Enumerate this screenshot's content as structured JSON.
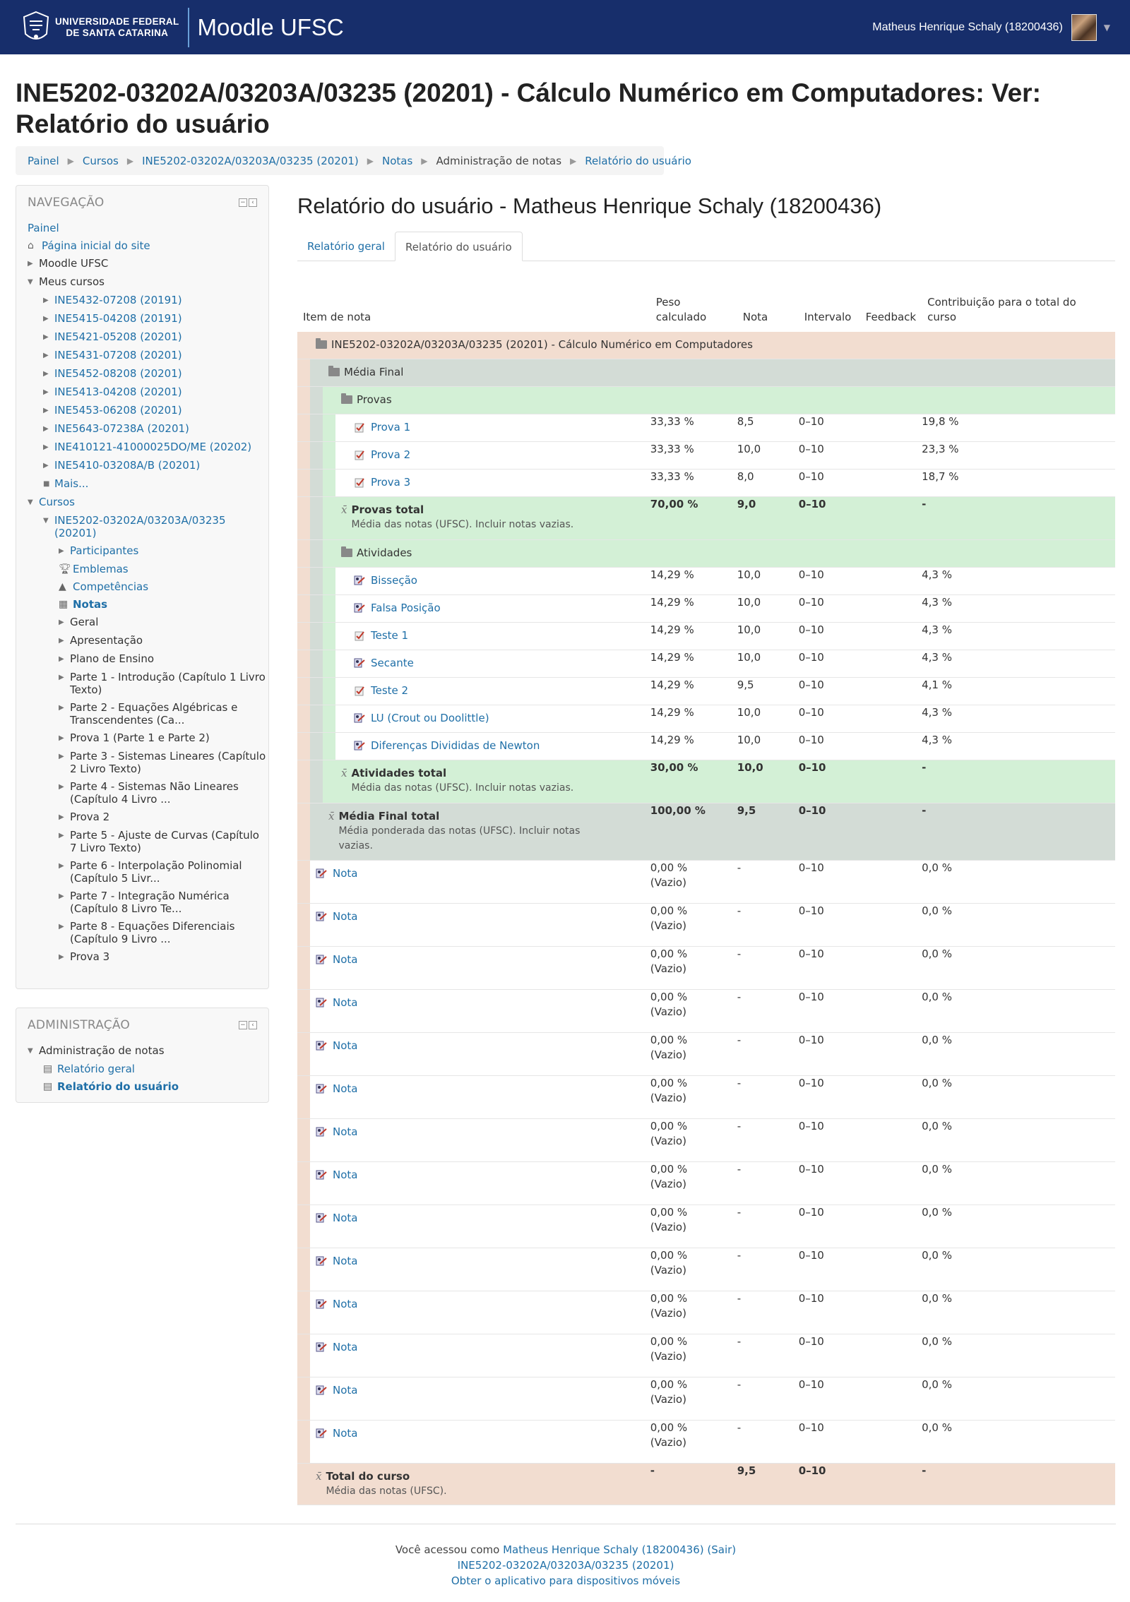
{
  "header": {
    "uni_line1": "UNIVERSIDADE FEDERAL",
    "uni_line2": "DE SANTA CATARINA",
    "brand": "Moodle UFSC",
    "user": "Matheus Henrique Schaly (18200436)"
  },
  "page_title": "INE5202-03202A/03203A/03235 (20201) - Cálculo Numérico em Computadores: Ver: Relatório do usuário",
  "breadcrumb": [
    "Painel",
    "Cursos",
    "INE5202-03202A/03203A/03235 (20201)",
    "Notas",
    "Administração de notas",
    "Relatório do usuário"
  ],
  "nav": {
    "title": "NAVEGAÇÃO",
    "painel": "Painel",
    "home": "Página inicial do site",
    "moodle": "Moodle UFSC",
    "meus_cursos": "Meus cursos",
    "courses": [
      "INE5432-07208 (20191)",
      "INE5415-04208 (20191)",
      "INE5421-05208 (20201)",
      "INE5431-07208 (20201)",
      "INE5452-08208 (20201)",
      "INE5413-04208 (20201)",
      "INE5453-06208 (20201)",
      "INE5643-07238A (20201)",
      "INE410121-41000025DO/ME (20202)",
      "INE5410-03208A/B (20201)"
    ],
    "mais": "Mais...",
    "cursos": "Cursos",
    "current_course_1": "INE5202-03202A/03203A/03235",
    "current_course_2": "(20201)",
    "participantes": "Participantes",
    "emblemas": "Emblemas",
    "competencias": "Competências",
    "notas": "Notas",
    "sections": [
      [
        "Geral"
      ],
      [
        "Apresentação"
      ],
      [
        "Plano de Ensino"
      ],
      [
        "Parte 1 - Introdução (Capítulo 1 Livro",
        "Texto)"
      ],
      [
        "Parte 2 - Equações Algébricas e",
        "Transcendentes (Ca..."
      ],
      [
        "Prova 1 (Parte 1 e Parte 2)"
      ],
      [
        "Parte 3 - Sistemas Lineares (Capítulo",
        "2 Livro Texto)"
      ],
      [
        "Parte 4 - Sistemas Não Lineares",
        "(Capítulo 4 Livro ..."
      ],
      [
        "Prova 2"
      ],
      [
        "Parte 5 - Ajuste de Curvas (Capítulo",
        "7 Livro Texto)"
      ],
      [
        "Parte 6 - Interpolação Polinomial",
        "(Capítulo 5 Livr..."
      ],
      [
        "Parte 7 - Integração Numérica",
        "(Capítulo 8 Livro Te..."
      ],
      [
        "Parte 8 - Equações Diferenciais",
        "(Capítulo 9 Livro ..."
      ],
      [
        "Prova 3"
      ]
    ]
  },
  "admin": {
    "title": "ADMINISTRAÇÃO",
    "grade_admin": "Administração de notas",
    "relatorio_geral": "Relatório geral",
    "relatorio_usuario": "Relatório do usuário"
  },
  "report": {
    "heading": "Relatório do usuário - Matheus Henrique Schaly (18200436)",
    "tab_geral": "Relatório geral",
    "tab_usuario": "Relatório do usuário"
  },
  "table": {
    "headers": {
      "item": "Item de nota",
      "peso1": "Peso",
      "peso2": "calculado",
      "nota": "Nota",
      "intervalo": "Intervalo",
      "feedback": "Feedback",
      "contrib1": "Contribuição para o total do",
      "contrib2": "curso"
    },
    "course": "INE5202-03202A/03203A/03235 (20201) - Cálculo Numérico em Computadores",
    "media_final": "Média Final",
    "provas": "Provas",
    "provas_rows": [
      {
        "name": "Prova 1",
        "peso": "33,33 %",
        "nota": "8,5",
        "intervalo": "0–10",
        "contrib": "19,8 %"
      },
      {
        "name": "Prova 2",
        "peso": "33,33 %",
        "nota": "10,0",
        "intervalo": "0–10",
        "contrib": "23,3 %"
      },
      {
        "name": "Prova 3",
        "peso": "33,33 %",
        "nota": "8,0",
        "intervalo": "0–10",
        "contrib": "18,7 %"
      }
    ],
    "provas_total": {
      "name": "Provas total",
      "desc": "Média das notas (UFSC). Incluir notas vazias.",
      "peso": "70,00 %",
      "nota": "9,0",
      "intervalo": "0–10",
      "contrib": "-"
    },
    "atividades": "Atividades",
    "atividades_rows": [
      {
        "name": "Bisseção",
        "peso": "14,29 %",
        "nota": "10,0",
        "intervalo": "0–10",
        "contrib": "4,3 %"
      },
      {
        "name": "Falsa Posição",
        "peso": "14,29 %",
        "nota": "10,0",
        "intervalo": "0–10",
        "contrib": "4,3 %"
      },
      {
        "name": "Teste 1",
        "peso": "14,29 %",
        "nota": "10,0",
        "intervalo": "0–10",
        "contrib": "4,3 %"
      },
      {
        "name": "Secante",
        "peso": "14,29 %",
        "nota": "10,0",
        "intervalo": "0–10",
        "contrib": "4,3 %"
      },
      {
        "name": "Teste 2",
        "peso": "14,29 %",
        "nota": "9,5",
        "intervalo": "0–10",
        "contrib": "4,1 %"
      },
      {
        "name": "LU (Crout ou Doolittle)",
        "peso": "14,29 %",
        "nota": "10,0",
        "intervalo": "0–10",
        "contrib": "4,3 %"
      },
      {
        "name": "Diferenças Divididas de Newton",
        "peso": "14,29 %",
        "nota": "10,0",
        "intervalo": "0–10",
        "contrib": "4,3 %"
      }
    ],
    "atividades_total": {
      "name": "Atividades total",
      "desc": "Média das notas (UFSC). Incluir notas vazias.",
      "peso": "30,00 %",
      "nota": "10,0",
      "intervalo": "0–10",
      "contrib": "-"
    },
    "media_total": {
      "name": "Média Final total",
      "desc1": "Média ponderada das notas (UFSC). Incluir notas",
      "desc2": "vazias.",
      "peso": "100,00 %",
      "nota": "9,5",
      "intervalo": "0–10",
      "contrib": "-"
    },
    "nota_rows": [
      {
        "name": "Nota",
        "peso": "0,00 %",
        "vazio": "(Vazio)",
        "nota": "-",
        "intervalo": "0–10",
        "contrib": "0,0 %"
      },
      {
        "name": "Nota",
        "peso": "0,00 %",
        "vazio": "(Vazio)",
        "nota": "-",
        "intervalo": "0–10",
        "contrib": "0,0 %"
      },
      {
        "name": "Nota",
        "peso": "0,00 %",
        "vazio": "(Vazio)",
        "nota": "-",
        "intervalo": "0–10",
        "contrib": "0,0 %"
      },
      {
        "name": "Nota",
        "peso": "0,00 %",
        "vazio": "(Vazio)",
        "nota": "-",
        "intervalo": "0–10",
        "contrib": "0,0 %"
      },
      {
        "name": "Nota",
        "peso": "0,00 %",
        "vazio": "(Vazio)",
        "nota": "-",
        "intervalo": "0–10",
        "contrib": "0,0 %"
      },
      {
        "name": "Nota",
        "peso": "0,00 %",
        "vazio": "(Vazio)",
        "nota": "-",
        "intervalo": "0–10",
        "contrib": "0,0 %"
      },
      {
        "name": "Nota",
        "peso": "0,00 %",
        "vazio": "(Vazio)",
        "nota": "-",
        "intervalo": "0–10",
        "contrib": "0,0 %"
      },
      {
        "name": "Nota",
        "peso": "0,00 %",
        "vazio": "(Vazio)",
        "nota": "-",
        "intervalo": "0–10",
        "contrib": "0,0 %"
      },
      {
        "name": "Nota",
        "peso": "0,00 %",
        "vazio": "(Vazio)",
        "nota": "-",
        "intervalo": "0–10",
        "contrib": "0,0 %"
      },
      {
        "name": "Nota",
        "peso": "0,00 %",
        "vazio": "(Vazio)",
        "nota": "-",
        "intervalo": "0–10",
        "contrib": "0,0 %"
      },
      {
        "name": "Nota",
        "peso": "0,00 %",
        "vazio": "(Vazio)",
        "nota": "-",
        "intervalo": "0–10",
        "contrib": "0,0 %"
      },
      {
        "name": "Nota",
        "peso": "0,00 %",
        "vazio": "(Vazio)",
        "nota": "-",
        "intervalo": "0–10",
        "contrib": "0,0 %"
      },
      {
        "name": "Nota",
        "peso": "0,00 %",
        "vazio": "(Vazio)",
        "nota": "-",
        "intervalo": "0–10",
        "contrib": "0,0 %"
      },
      {
        "name": "Nota",
        "peso": "0,00 %",
        "vazio": "(Vazio)",
        "nota": "-",
        "intervalo": "0–10",
        "contrib": "0,0 %"
      }
    ],
    "course_total": {
      "name": "Total do curso",
      "desc": "Média das notas (UFSC).",
      "peso": "-",
      "nota": "9,5",
      "intervalo": "0–10",
      "contrib": "-"
    }
  },
  "footer": {
    "prefix": "Você acessou como ",
    "user": "Matheus Henrique Schaly (18200436)",
    "sair": "(Sair)",
    "course": "INE5202-03202A/03203A/03235 (20201)",
    "app": "Obter o aplicativo para dispositivos móveis"
  },
  "colors": {
    "navbar": "#172e6b",
    "link": "#1f6fa7",
    "peach": "#f2ddd0",
    "grey": "#d3dcd6",
    "green": "#d3f0d6"
  }
}
